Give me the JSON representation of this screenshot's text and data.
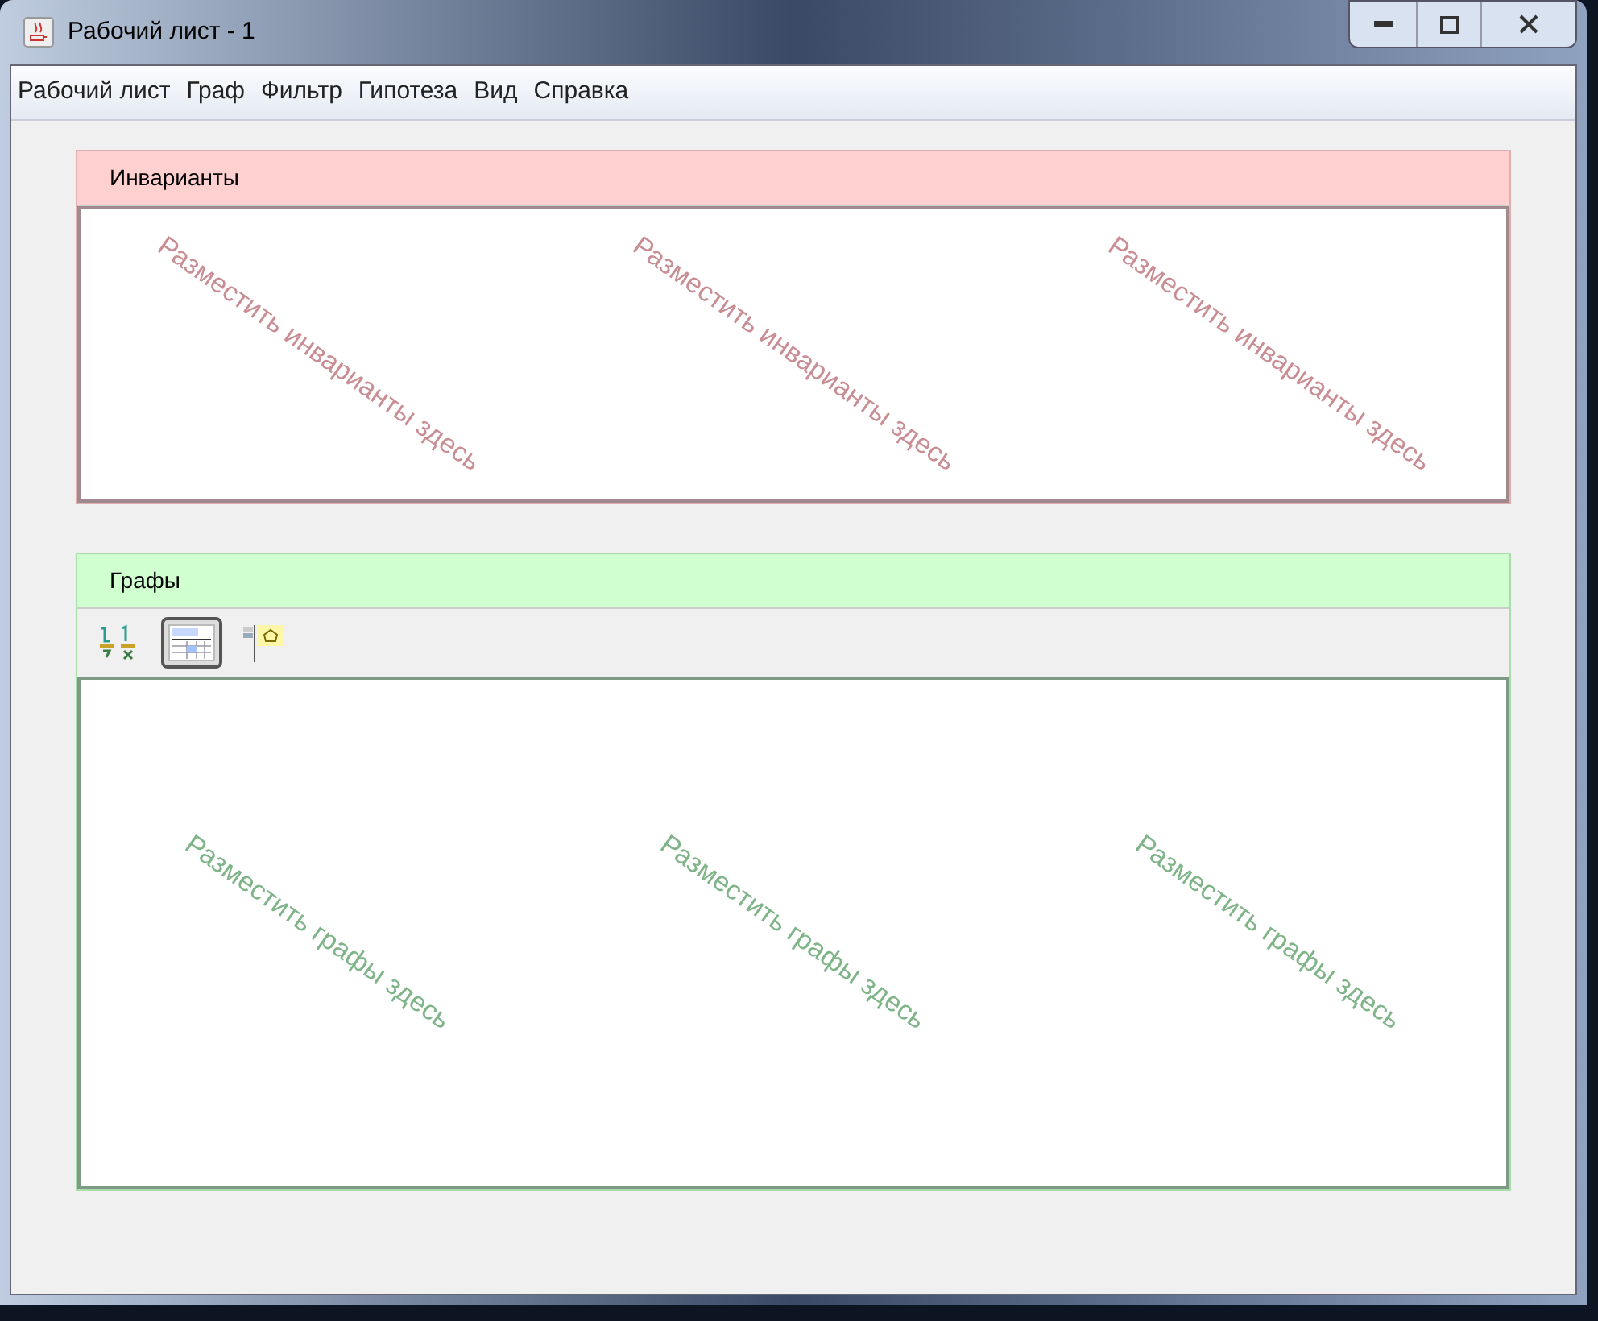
{
  "window": {
    "title": "Рабочий лист - 1"
  },
  "menu": [
    "Рабочий лист",
    "Граф",
    "Фильтр",
    "Гипотеза",
    "Вид",
    "Справка"
  ],
  "panels": [
    {
      "title": "Инварианты",
      "color": "#ffd0d0",
      "drop_hints": [
        "Разместить инварианты здесь",
        "Разместить инварианты здесь",
        "Разместить инварианты здесь"
      ]
    },
    {
      "title": "Графы",
      "color": "#d0ffd0",
      "drop_hints": [
        "Разместить графы здесь",
        "Разместить графы здесь",
        "Разместить графы здесь"
      ],
      "toolbar": [
        {
          "kind": "sort",
          "selected": false
        },
        {
          "kind": "table",
          "selected": true
        },
        {
          "kind": "graph",
          "selected": false
        }
      ]
    }
  ]
}
